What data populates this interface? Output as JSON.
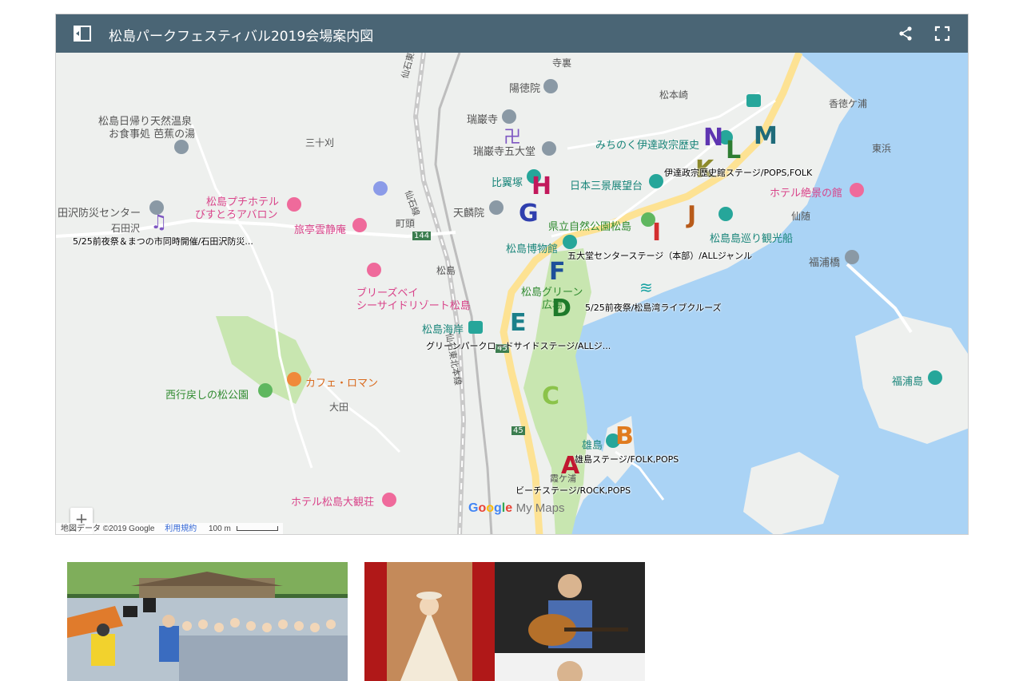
{
  "header": {
    "title": "松島パークフェスティバル2019会場案内図",
    "star_glyph": "★"
  },
  "places": {
    "terauraya": "寺裏",
    "yotokuin": "陽徳院",
    "matsumotozaki": "松本崎",
    "kozukeura": "香徳ケ浦",
    "onsen_line1": "松島日帰り天然温泉",
    "onsen_line2": "お食事処 芭蕉の湯",
    "sanjuukari": "三十刈",
    "zuiganji": "瑞巌寺",
    "zuiganji_godaido": "瑞巌寺五大堂",
    "date_museum": "みちのく伊達政宗歴史",
    "higashihama": "東浜",
    "hiyokuzuka": "比翼塚",
    "nihon_sankei": "日本三景展望台",
    "hotel_zekkei": "ホテル絶景の館",
    "tashirozawa": "田沢防災センター",
    "ishidazawa": "石田沢",
    "petit_hotel_line1": "松島プチホテル",
    "petit_hotel_line2": "びすとろアバロン",
    "ryotei": "旅亭雲静庵",
    "machigashira": "町頭",
    "tenrinin": "天麟院",
    "kenritsu_park": "県立自然公園松島",
    "sendai": "仙随",
    "island_cruise": "松島島巡り観光船",
    "matsushima_museum": "松島博物館",
    "fukuurabashi": "福浦橋",
    "matsushima": "松島",
    "breeze_line1": "ブリーズベイ",
    "breeze_line2": "シーサイドリゾート松島",
    "green_plaza_line1": "松島グリーン",
    "green_plaza_line2": "広場",
    "kaigan_station": "松島海岸",
    "fukuurajima": "福浦島",
    "cafe_roman": "カフェ・ロマン",
    "saigyo_park": "西行戻しの松公園",
    "ota": "大田",
    "ojima": "雄島",
    "hotel_taikanso": "ホテル松島大観荘",
    "kasumigaura": "霞ケ浦",
    "road_senseki_1": "仙石東北ライン",
    "road_senseki_2": "仙石線",
    "road_senseki_3": "仙石東北本線",
    "road_45": "45",
    "road_144": "144"
  },
  "stages": {
    "ishidazawa_stage": "5/25前夜祭＆まつの市同時開催/石田沢防災...",
    "date_stage": "伊達政宗歴史館ステージ/POPS,FOLK",
    "godaido_stage": "五大堂センターステージ（本部）/ALLジャンル",
    "cruise_stage": "5/25前夜祭/松島湾ライブクルーズ",
    "greenpark_stage": "グリーンパークロードサイドステージ/ALLジ...",
    "ojima_stage": "雄島ステージ/FOLK,POPS",
    "beach_stage": "ビーチステージ/ROCK,POPS"
  },
  "markers": {
    "A": "A",
    "B": "B",
    "C": "C",
    "D": "D",
    "E": "E",
    "F": "F",
    "G": "G",
    "H": "H",
    "I": "I",
    "J": "J",
    "K": "K",
    "L": "L",
    "M": "M",
    "N": "N"
  },
  "zoom": {
    "plus": "+",
    "minus": "−"
  },
  "attribution": {
    "data": "地図データ ©2019 Google",
    "terms": "利用規約",
    "scale": "100 m"
  },
  "logo": {
    "google": "Google",
    "mymaps": "My Maps"
  },
  "colors": {
    "header_bg": "#4a6575",
    "water": "#aad3f5",
    "land": "#eef0ee",
    "park": "#c8e6b0",
    "road": "#fde293",
    "marker_a": "#c0172f",
    "marker_b": "#e07b1f",
    "marker_c": "#8bc34a",
    "marker_d": "#1e7a2a",
    "marker_e": "#1b7f8a",
    "marker_f": "#1d4f9a",
    "marker_g": "#2f3fae",
    "marker_h": "#c2185b",
    "marker_i": "#d32f2f",
    "marker_j": "#b85b1a",
    "marker_k": "#8d8a2b",
    "marker_l": "#2e7d32",
    "marker_m": "#1f6b7a",
    "marker_n": "#5e35b1"
  },
  "icons": [
    "side-panel-icon",
    "share-icon",
    "fullscreen-icon",
    "star-icon",
    "music-note-icon",
    "temple-icon",
    "wave-icon"
  ]
}
